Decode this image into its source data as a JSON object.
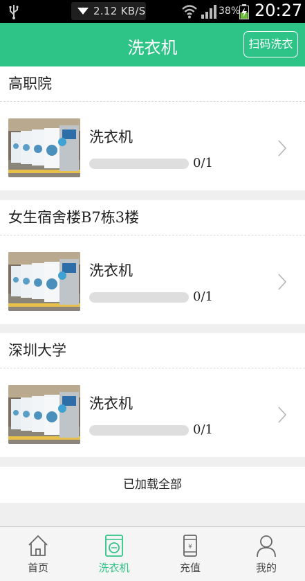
{
  "status_bar": {
    "network_speed": "2.12 KB/S",
    "battery_percent": "38%",
    "time": "20:27"
  },
  "header": {
    "title": "洗衣机",
    "scan_button": "扫码洗衣"
  },
  "groups": [
    {
      "location": "高职院",
      "machine": {
        "name": "洗衣机",
        "usage": "0/1",
        "progress": 0
      }
    },
    {
      "location": "女生宿舍楼B7栋3楼",
      "machine": {
        "name": "洗衣机",
        "usage": "0/1",
        "progress": 0
      }
    },
    {
      "location": "深圳大学",
      "machine": {
        "name": "洗衣机",
        "usage": "0/1",
        "progress": 0
      }
    }
  ],
  "footer_note": "已加载全部",
  "tabs": [
    {
      "label": "首页",
      "icon": "home-icon",
      "active": false
    },
    {
      "label": "洗衣机",
      "icon": "washer-icon",
      "active": true
    },
    {
      "label": "充值",
      "icon": "recharge-icon",
      "active": false
    },
    {
      "label": "我的",
      "icon": "user-icon",
      "active": false
    }
  ],
  "colors": {
    "accent": "#2ec487",
    "background": "#efefef"
  }
}
